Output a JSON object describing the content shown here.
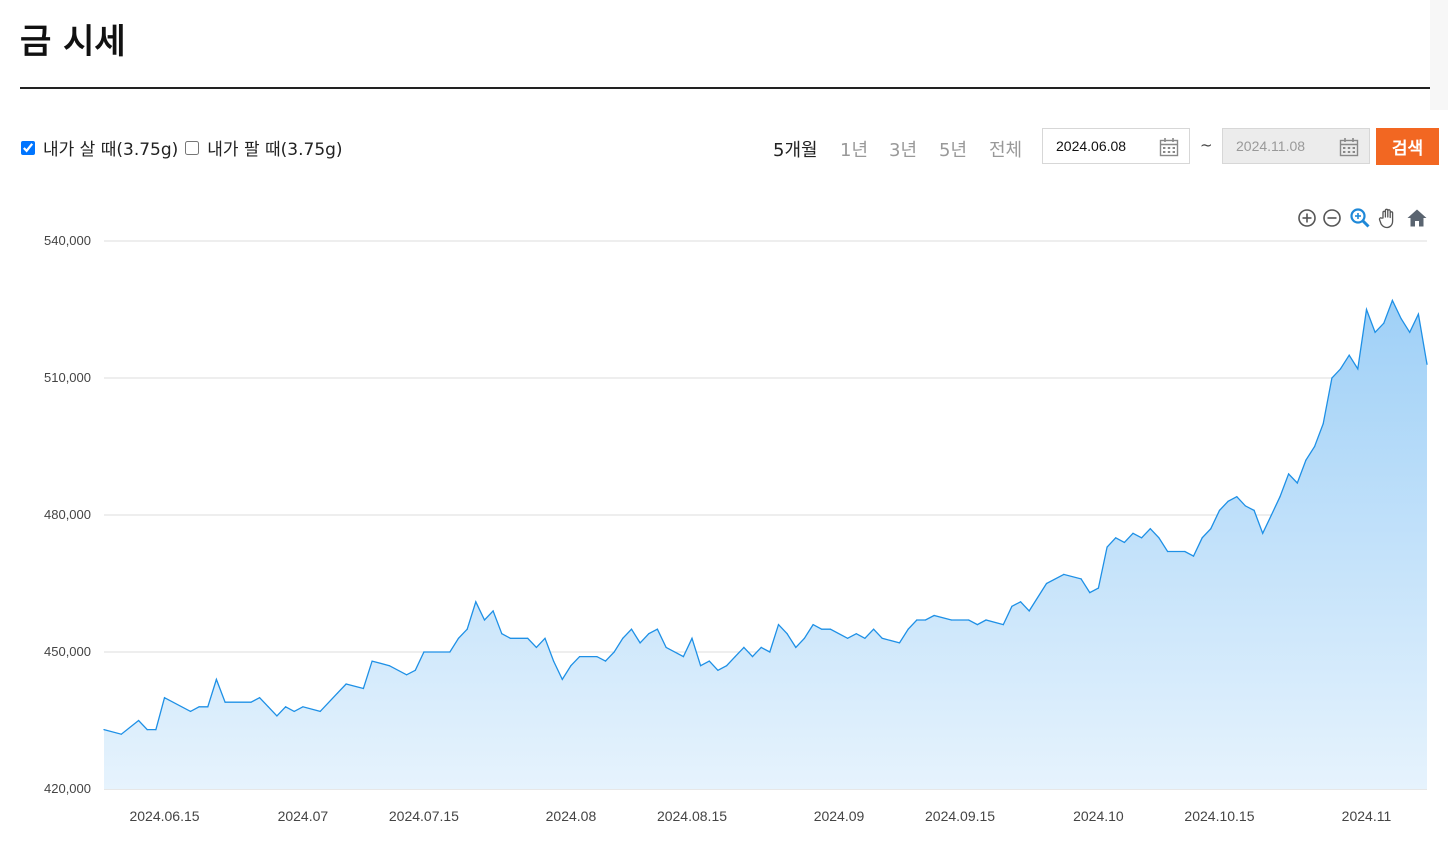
{
  "page": {
    "title": "금 시세"
  },
  "filters": {
    "buy_label": "내가 살 때(3.75g)",
    "buy_checked": true,
    "sell_label": "내가 팔 때(3.75g)",
    "sell_checked": false
  },
  "periods": [
    {
      "label": "5개월",
      "active": true
    },
    {
      "label": "1년",
      "active": false
    },
    {
      "label": "3년",
      "active": false
    },
    {
      "label": "5년",
      "active": false
    },
    {
      "label": "전체",
      "active": false
    }
  ],
  "date_range": {
    "start": "2024.06.08",
    "end": "2024.11.08",
    "separator": "~",
    "search_label": "검색"
  },
  "colors": {
    "accent": "#f26722",
    "line": "#1e90e6",
    "area_top": "#9fd0f7",
    "area_bottom": "#e6f3fd"
  },
  "chart_tools": [
    "zoom-in-icon",
    "zoom-out-icon",
    "magnify-icon",
    "pan-hand-icon",
    "home-icon"
  ],
  "chart_data": {
    "type": "area",
    "title": "",
    "xlabel": "",
    "ylabel": "",
    "ylim": [
      420000,
      540000
    ],
    "yticks": [
      420000,
      450000,
      480000,
      510000,
      540000
    ],
    "ytick_labels": [
      "420,000",
      "450,000",
      "480,000",
      "510,000",
      "540,000"
    ],
    "xlim": [
      "2024-06-08",
      "2024-11-08"
    ],
    "xticks": [
      {
        "date": "2024-06-15",
        "label": "2024.06.15"
      },
      {
        "date": "2024-07-01",
        "label": "2024.07"
      },
      {
        "date": "2024-07-15",
        "label": "2024.07.15"
      },
      {
        "date": "2024-08-01",
        "label": "2024.08"
      },
      {
        "date": "2024-08-15",
        "label": "2024.08.15"
      },
      {
        "date": "2024-09-01",
        "label": "2024.09"
      },
      {
        "date": "2024-09-15",
        "label": "2024.09.15"
      },
      {
        "date": "2024-10-01",
        "label": "2024.10"
      },
      {
        "date": "2024-10-15",
        "label": "2024.10.15"
      },
      {
        "date": "2024-11-01",
        "label": "2024.11"
      }
    ],
    "grid": true,
    "series": [
      {
        "values": [
          [
            "2024-06-08",
            433000
          ],
          [
            "2024-06-10",
            432000
          ],
          [
            "2024-06-12",
            435000
          ],
          [
            "2024-06-13",
            433000
          ],
          [
            "2024-06-14",
            433000
          ],
          [
            "2024-06-15",
            440000
          ],
          [
            "2024-06-18",
            437000
          ],
          [
            "2024-06-19",
            438000
          ],
          [
            "2024-06-20",
            438000
          ],
          [
            "2024-06-21",
            444000
          ],
          [
            "2024-06-22",
            439000
          ],
          [
            "2024-06-25",
            439000
          ],
          [
            "2024-06-26",
            440000
          ],
          [
            "2024-06-27",
            438000
          ],
          [
            "2024-06-28",
            436000
          ],
          [
            "2024-06-29",
            438000
          ],
          [
            "2024-06-30",
            437000
          ],
          [
            "2024-07-01",
            438000
          ],
          [
            "2024-07-03",
            437000
          ],
          [
            "2024-07-05",
            441000
          ],
          [
            "2024-07-06",
            443000
          ],
          [
            "2024-07-08",
            442000
          ],
          [
            "2024-07-09",
            448000
          ],
          [
            "2024-07-11",
            447000
          ],
          [
            "2024-07-13",
            445000
          ],
          [
            "2024-07-14",
            446000
          ],
          [
            "2024-07-15",
            450000
          ],
          [
            "2024-07-18",
            450000
          ],
          [
            "2024-07-19",
            453000
          ],
          [
            "2024-07-20",
            455000
          ],
          [
            "2024-07-21",
            461000
          ],
          [
            "2024-07-22",
            457000
          ],
          [
            "2024-07-23",
            459000
          ],
          [
            "2024-07-24",
            454000
          ],
          [
            "2024-07-25",
            453000
          ],
          [
            "2024-07-27",
            453000
          ],
          [
            "2024-07-28",
            451000
          ],
          [
            "2024-07-29",
            453000
          ],
          [
            "2024-07-30",
            448000
          ],
          [
            "2024-07-31",
            444000
          ],
          [
            "2024-08-01",
            447000
          ],
          [
            "2024-08-02",
            449000
          ],
          [
            "2024-08-04",
            449000
          ],
          [
            "2024-08-05",
            448000
          ],
          [
            "2024-08-06",
            450000
          ],
          [
            "2024-08-07",
            453000
          ],
          [
            "2024-08-08",
            455000
          ],
          [
            "2024-08-09",
            452000
          ],
          [
            "2024-08-10",
            454000
          ],
          [
            "2024-08-11",
            455000
          ],
          [
            "2024-08-12",
            451000
          ],
          [
            "2024-08-14",
            449000
          ],
          [
            "2024-08-15",
            453000
          ],
          [
            "2024-08-16",
            447000
          ],
          [
            "2024-08-17",
            448000
          ],
          [
            "2024-08-18",
            446000
          ],
          [
            "2024-08-19",
            447000
          ],
          [
            "2024-08-20",
            449000
          ],
          [
            "2024-08-21",
            451000
          ],
          [
            "2024-08-22",
            449000
          ],
          [
            "2024-08-23",
            451000
          ],
          [
            "2024-08-24",
            450000
          ],
          [
            "2024-08-25",
            456000
          ],
          [
            "2024-08-26",
            454000
          ],
          [
            "2024-08-27",
            451000
          ],
          [
            "2024-08-28",
            453000
          ],
          [
            "2024-08-29",
            456000
          ],
          [
            "2024-08-30",
            455000
          ],
          [
            "2024-08-31",
            455000
          ],
          [
            "2024-09-02",
            453000
          ],
          [
            "2024-09-03",
            454000
          ],
          [
            "2024-09-04",
            453000
          ],
          [
            "2024-09-05",
            455000
          ],
          [
            "2024-09-06",
            453000
          ],
          [
            "2024-09-08",
            452000
          ],
          [
            "2024-09-09",
            455000
          ],
          [
            "2024-09-10",
            457000
          ],
          [
            "2024-09-11",
            457000
          ],
          [
            "2024-09-12",
            458000
          ],
          [
            "2024-09-14",
            457000
          ],
          [
            "2024-09-16",
            457000
          ],
          [
            "2024-09-17",
            456000
          ],
          [
            "2024-09-18",
            457000
          ],
          [
            "2024-09-20",
            456000
          ],
          [
            "2024-09-21",
            460000
          ],
          [
            "2024-09-22",
            461000
          ],
          [
            "2024-09-23",
            459000
          ],
          [
            "2024-09-25",
            465000
          ],
          [
            "2024-09-27",
            467000
          ],
          [
            "2024-09-29",
            466000
          ],
          [
            "2024-09-30",
            463000
          ],
          [
            "2024-10-01",
            464000
          ],
          [
            "2024-10-02",
            473000
          ],
          [
            "2024-10-03",
            475000
          ],
          [
            "2024-10-04",
            474000
          ],
          [
            "2024-10-05",
            476000
          ],
          [
            "2024-10-06",
            475000
          ],
          [
            "2024-10-07",
            477000
          ],
          [
            "2024-10-08",
            475000
          ],
          [
            "2024-10-09",
            472000
          ],
          [
            "2024-10-11",
            472000
          ],
          [
            "2024-10-12",
            471000
          ],
          [
            "2024-10-13",
            475000
          ],
          [
            "2024-10-14",
            477000
          ],
          [
            "2024-10-15",
            481000
          ],
          [
            "2024-10-16",
            483000
          ],
          [
            "2024-10-17",
            484000
          ],
          [
            "2024-10-18",
            482000
          ],
          [
            "2024-10-19",
            481000
          ],
          [
            "2024-10-20",
            476000
          ],
          [
            "2024-10-21",
            480000
          ],
          [
            "2024-10-22",
            484000
          ],
          [
            "2024-10-23",
            489000
          ],
          [
            "2024-10-24",
            487000
          ],
          [
            "2024-10-25",
            492000
          ],
          [
            "2024-10-26",
            495000
          ],
          [
            "2024-10-27",
            500000
          ],
          [
            "2024-10-28",
            510000
          ],
          [
            "2024-10-29",
            512000
          ],
          [
            "2024-10-30",
            515000
          ],
          [
            "2024-10-31",
            512000
          ],
          [
            "2024-11-01",
            525000
          ],
          [
            "2024-11-02",
            520000
          ],
          [
            "2024-11-03",
            522000
          ],
          [
            "2024-11-04",
            527000
          ],
          [
            "2024-11-05",
            523000
          ],
          [
            "2024-11-06",
            520000
          ],
          [
            "2024-11-07",
            524000
          ],
          [
            "2024-11-08",
            513000
          ]
        ]
      }
    ]
  }
}
